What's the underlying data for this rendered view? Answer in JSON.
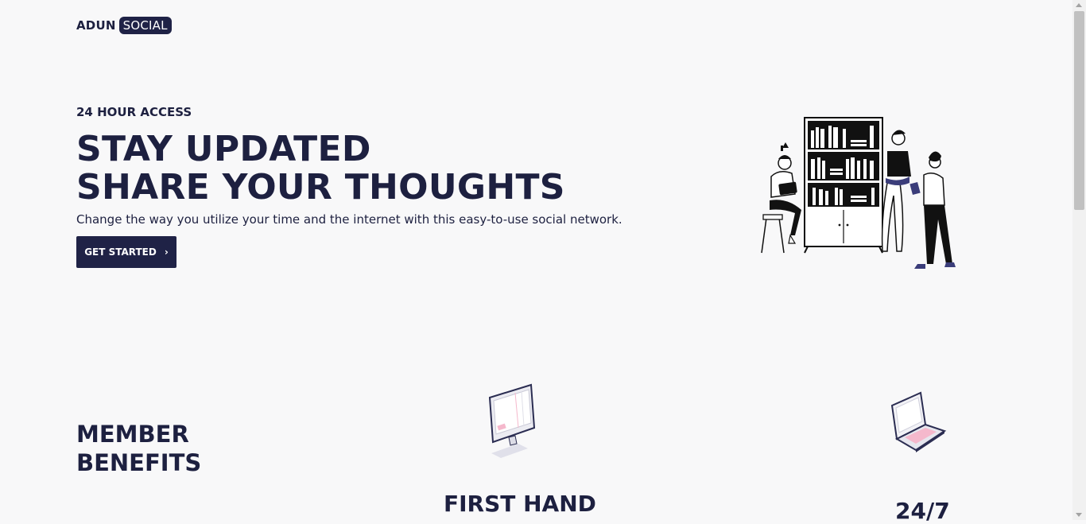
{
  "brand": {
    "name_part1": "ADUN",
    "name_part2": "SOCIAL"
  },
  "hero": {
    "eyebrow": "24 HOUR ACCESS",
    "headline_line1": "STAY UPDATED",
    "headline_line2": "SHARE YOUR THOUGHTS",
    "description": "Change the way you utilize your time and the internet with this easy-to-use social network.",
    "cta_label": "GET STARTED",
    "cta_icon": "chevron-right-icon",
    "cta_glyph": "›",
    "illustration": "people-with-bookshelf-illustration"
  },
  "benefits": {
    "title_line1": "MEMBER",
    "title_line2": "BENEFITS",
    "items": [
      {
        "title": "FIRST HAND",
        "icon": "desktop-computer-icon"
      },
      {
        "title": "24/7",
        "icon": "laptop-icon"
      }
    ]
  },
  "colors": {
    "primary": "#1f2246",
    "text": "#1d2040",
    "background": "#f8f8f9",
    "accent_pink": "#f5b8cc"
  }
}
